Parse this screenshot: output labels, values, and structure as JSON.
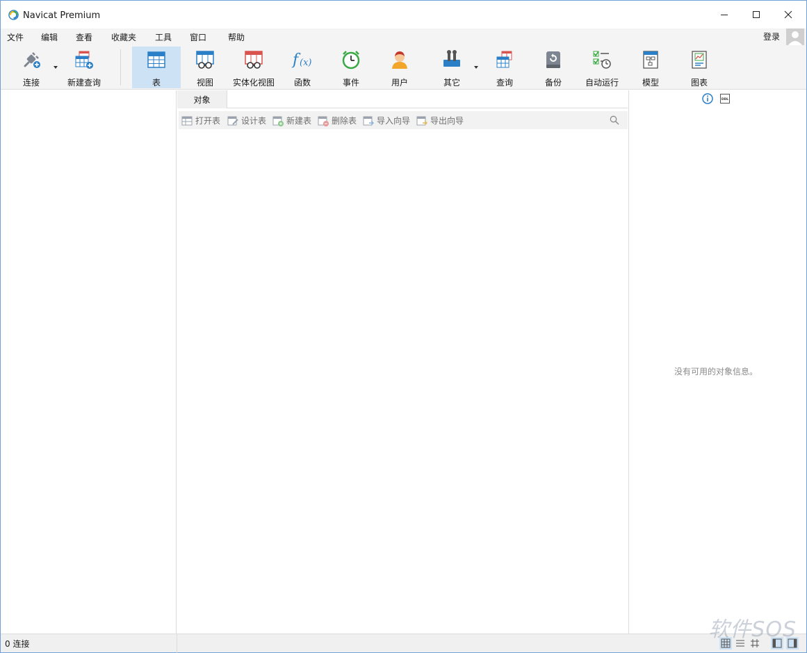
{
  "window": {
    "title": "Navicat Premium"
  },
  "menu": {
    "items": [
      "文件",
      "编辑",
      "查看",
      "收藏夹",
      "工具",
      "窗口",
      "帮助"
    ],
    "login": "登录"
  },
  "toolbar": {
    "connect": "连接",
    "new_query": "新建查询",
    "table": "表",
    "view": "视图",
    "materialized_view": "实体化视图",
    "function": "函数",
    "event": "事件",
    "user": "用户",
    "other": "其它",
    "query": "查询",
    "backup": "备份",
    "automation": "自动运行",
    "model": "模型",
    "chart": "图表"
  },
  "tabs": {
    "objects": "对象"
  },
  "object_toolbar": {
    "open_table": "打开表",
    "design_table": "设计表",
    "new_table": "新建表",
    "delete_table": "删除表",
    "import_wizard": "导入向导",
    "export_wizard": "导出向导"
  },
  "info_pane": {
    "empty_message": "没有可用的对象信息。"
  },
  "status": {
    "connections": "0 连接"
  },
  "watermark": "软件SOS",
  "colors": {
    "accent": "#2b7fc7",
    "active_tool_bg": "#cde3f5",
    "chrome_bg": "#f4f4f4"
  }
}
